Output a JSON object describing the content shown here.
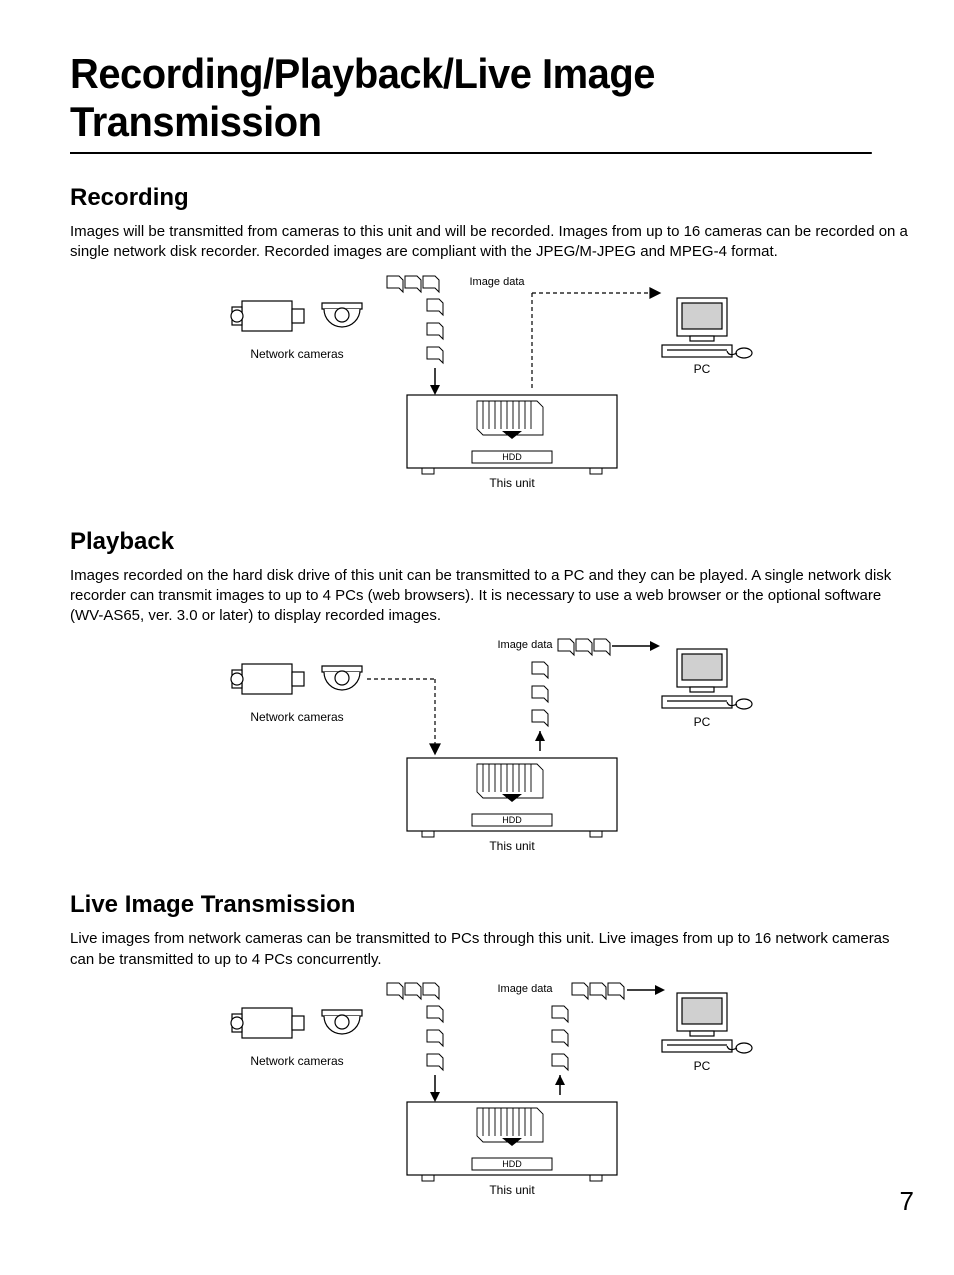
{
  "page_title": "Recording/Playback/Live Image Transmission",
  "page_number": "7",
  "sections": {
    "recording": {
      "title": "Recording",
      "body": "Images will be transmitted from cameras to this unit and will be recorded. Images from up to 16 cameras can be recorded on a single network disk recorder. Recorded images are compliant with the JPEG/M-JPEG and MPEG-4 format."
    },
    "playback": {
      "title": "Playback",
      "body": "Images recorded on the hard disk drive of this unit can be transmitted to a PC and they can be played. A single network disk recorder can transmit images to up to 4 PCs (web browsers). It is necessary to use a web browser or the optional software (WV-AS65, ver. 3.0 or later) to display recorded images."
    },
    "live": {
      "title": "Live Image Transmission",
      "body": "Live images from network cameras can be transmitted to PCs through this unit. Live images from up to 16 network cameras can be transmitted to up to 4 PCs concurrently."
    }
  },
  "diagram_labels": {
    "image_data": "Image data",
    "network_cameras": "Network cameras",
    "pc": "PC",
    "hdd": "HDD",
    "this_unit": "This unit"
  }
}
